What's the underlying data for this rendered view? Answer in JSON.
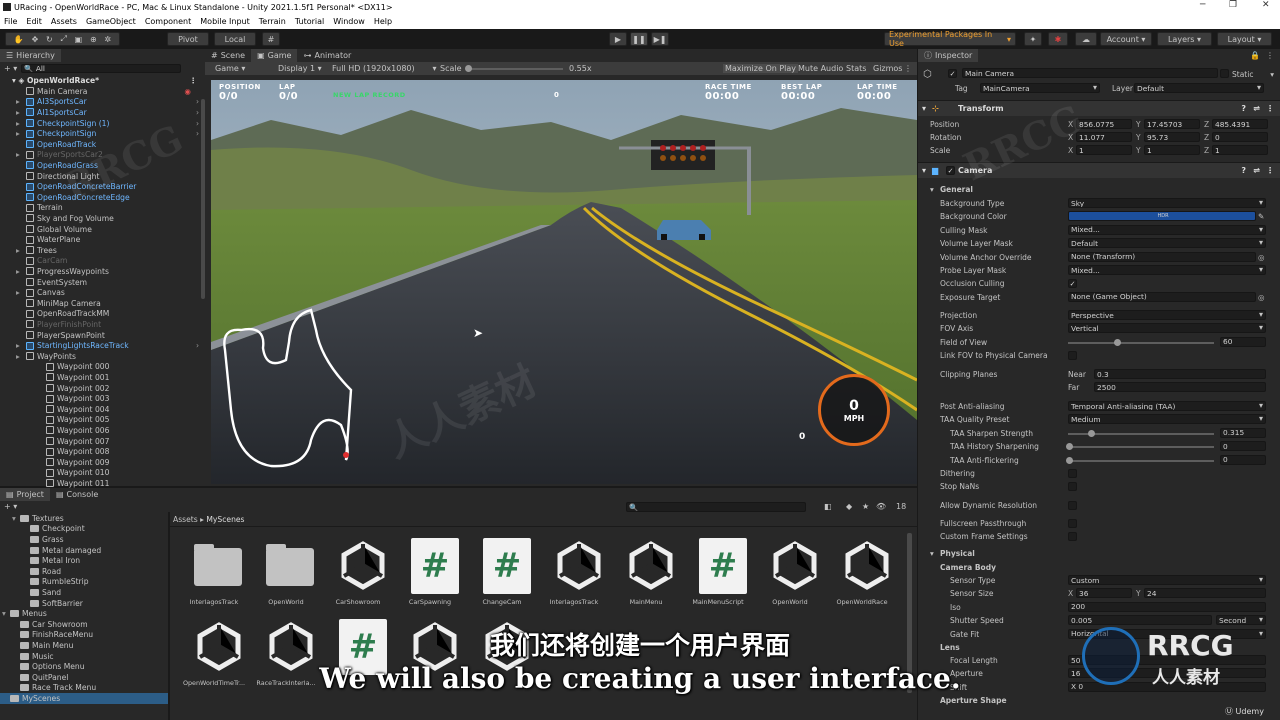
{
  "window": {
    "title": "URacing - OpenWorldRace - PC, Mac & Linux Standalone - Unity 2021.1.5f1 Personal* <DX11>"
  },
  "menu": [
    "File",
    "Edit",
    "Assets",
    "GameObject",
    "Component",
    "Mobile Input",
    "Terrain",
    "Tutorial",
    "Window",
    "Help"
  ],
  "toolbar": {
    "pivot": "Pivot",
    "local": "Local",
    "experimental": "Experimental Packages In Use",
    "account": "Account",
    "layers": "Layers",
    "layout": "Layout"
  },
  "hierarchy": {
    "tab": "Hierarchy",
    "search": "All",
    "scene": "OpenWorldRace*",
    "items": [
      {
        "label": "Main Camera",
        "style": "normal",
        "indent": 1,
        "arrow": false
      },
      {
        "label": "AI3SportsCar",
        "style": "blue",
        "indent": 1,
        "arrow": true
      },
      {
        "label": "AI1SportsCar",
        "style": "blue",
        "indent": 1,
        "arrow": true
      },
      {
        "label": "CheckpointSign (1)",
        "style": "blue",
        "indent": 1,
        "arrow": true
      },
      {
        "label": "CheckpointSign",
        "style": "blue",
        "indent": 1,
        "arrow": true
      },
      {
        "label": "OpenRoadTrack",
        "style": "blue",
        "indent": 1,
        "arrow": false
      },
      {
        "label": "PlayerSportsCar2",
        "style": "grey",
        "indent": 1,
        "arrow": true
      },
      {
        "label": "OpenRoadGrass",
        "style": "blue",
        "indent": 1,
        "arrow": false
      },
      {
        "label": "Directional Light",
        "style": "normal",
        "indent": 1,
        "arrow": false
      },
      {
        "label": "OpenRoadConcreteBarrier",
        "style": "blue",
        "indent": 1,
        "arrow": false
      },
      {
        "label": "OpenRoadConcreteEdge",
        "style": "blue",
        "indent": 1,
        "arrow": false
      },
      {
        "label": "Terrain",
        "style": "normal",
        "indent": 1,
        "arrow": false
      },
      {
        "label": "Sky and Fog Volume",
        "style": "normal",
        "indent": 1,
        "arrow": false
      },
      {
        "label": "Global Volume",
        "style": "normal",
        "indent": 1,
        "arrow": false
      },
      {
        "label": "WaterPlane",
        "style": "normal",
        "indent": 1,
        "arrow": false
      },
      {
        "label": "Trees",
        "style": "normal",
        "indent": 1,
        "arrow": true
      },
      {
        "label": "CarCam",
        "style": "grey",
        "indent": 1,
        "arrow": false
      },
      {
        "label": "ProgressWaypoints",
        "style": "normal",
        "indent": 1,
        "arrow": true
      },
      {
        "label": "EventSystem",
        "style": "normal",
        "indent": 1,
        "arrow": false
      },
      {
        "label": "Canvas",
        "style": "normal",
        "indent": 1,
        "arrow": true
      },
      {
        "label": "MiniMap Camera",
        "style": "normal",
        "indent": 1,
        "arrow": false
      },
      {
        "label": "OpenRoadTrackMM",
        "style": "normal",
        "indent": 1,
        "arrow": false
      },
      {
        "label": "PlayerFinishPoint",
        "style": "grey",
        "indent": 1,
        "arrow": false
      },
      {
        "label": "PlayerSpawnPoint",
        "style": "normal",
        "indent": 1,
        "arrow": false
      },
      {
        "label": "StartingLightsRaceTrack",
        "style": "blue",
        "indent": 1,
        "arrow": true
      },
      {
        "label": "WayPoints",
        "style": "normal",
        "indent": 1,
        "arrow": true
      },
      {
        "label": "Waypoint 000",
        "style": "normal",
        "indent": 2,
        "arrow": false
      },
      {
        "label": "Waypoint 001",
        "style": "normal",
        "indent": 2,
        "arrow": false
      },
      {
        "label": "Waypoint 002",
        "style": "normal",
        "indent": 2,
        "arrow": false
      },
      {
        "label": "Waypoint 003",
        "style": "normal",
        "indent": 2,
        "arrow": false
      },
      {
        "label": "Waypoint 004",
        "style": "normal",
        "indent": 2,
        "arrow": false
      },
      {
        "label": "Waypoint 005",
        "style": "normal",
        "indent": 2,
        "arrow": false
      },
      {
        "label": "Waypoint 006",
        "style": "normal",
        "indent": 2,
        "arrow": false
      },
      {
        "label": "Waypoint 007",
        "style": "normal",
        "indent": 2,
        "arrow": false
      },
      {
        "label": "Waypoint 008",
        "style": "normal",
        "indent": 2,
        "arrow": false
      },
      {
        "label": "Waypoint 009",
        "style": "normal",
        "indent": 2,
        "arrow": false
      },
      {
        "label": "Waypoint 010",
        "style": "normal",
        "indent": 2,
        "arrow": false
      },
      {
        "label": "Waypoint 011",
        "style": "normal",
        "indent": 2,
        "arrow": false
      }
    ]
  },
  "game": {
    "tabs": [
      "Scene",
      "Game",
      "Animator"
    ],
    "display_mode": "Game",
    "display": "Display 1",
    "resolution": "Full HD (1920x1080)",
    "scale_label": "Scale",
    "scale_value": "0.55x",
    "options": [
      "Maximize On Play",
      "Mute Audio",
      "Stats",
      "Gizmos"
    ],
    "hud": {
      "position_label": "POSITION",
      "position_value": "0/0",
      "lap_label": "LAP",
      "lap_value": "0/0",
      "new_lap": "NEW LAP RECORD",
      "center_value": "0",
      "race_time_label": "RACE TIME",
      "race_time_value": "00:00",
      "best_lap_label": "BEST LAP",
      "best_lap_value": "00:00",
      "lap_time_label": "LAP TIME",
      "lap_time_value": "00:00",
      "speed_value": "0",
      "speed_unit": "MPH",
      "gear_value": "0"
    }
  },
  "inspector": {
    "tab": "Inspector",
    "object_name": "Main Camera",
    "static_label": "Static",
    "tag_label": "Tag",
    "tag_value": "MainCamera",
    "layer_label": "Layer",
    "layer_value": "Default",
    "transform": {
      "title": "Transform",
      "position": {
        "label": "Position",
        "x": "856.0775",
        "y": "17.45703",
        "z": "485.4391"
      },
      "rotation": {
        "label": "Rotation",
        "x": "11.077",
        "y": "95.73",
        "z": "0"
      },
      "scale": {
        "label": "Scale",
        "x": "1",
        "y": "1",
        "z": "1"
      }
    },
    "camera_title": "Camera",
    "general_label": "General",
    "props": [
      {
        "label": "Background Type",
        "value": "Sky",
        "kind": "dd"
      },
      {
        "label": "Background Color",
        "value": "HDR",
        "kind": "color"
      },
      {
        "label": "Culling Mask",
        "value": "Mixed...",
        "kind": "dd"
      },
      {
        "label": "Volume Layer Mask",
        "value": "Default",
        "kind": "dd"
      },
      {
        "label": "Volume Anchor Override",
        "value": "None (Transform)",
        "kind": "obj"
      },
      {
        "label": "Probe Layer Mask",
        "value": "Mixed...",
        "kind": "dd"
      },
      {
        "label": "Occlusion Culling",
        "value": "✓",
        "kind": "chk"
      },
      {
        "label": "Exposure Target",
        "value": "None (Game Object)",
        "kind": "obj"
      }
    ],
    "projection": [
      {
        "label": "Projection",
        "value": "Perspective",
        "kind": "dd"
      },
      {
        "label": "FOV Axis",
        "value": "Vertical",
        "kind": "dd"
      },
      {
        "label": "Field of View",
        "value": "60",
        "kind": "slider",
        "fill": 0.33
      },
      {
        "label": "Link FOV to Physical Camera",
        "value": "",
        "kind": "chk"
      }
    ],
    "clipping": {
      "label": "Clipping Planes",
      "near_label": "Near",
      "near": "0.3",
      "far_label": "Far",
      "far": "2500"
    },
    "aa": [
      {
        "label": "Post Anti-aliasing",
        "value": "Temporal Anti-aliasing (TAA)",
        "kind": "dd"
      },
      {
        "label": "TAA Quality Preset",
        "value": "Medium",
        "kind": "dd"
      },
      {
        "label": "TAA Sharpen Strength",
        "value": "0.315",
        "kind": "slider",
        "fill": 0.15
      },
      {
        "label": "TAA History Sharpening",
        "value": "0",
        "kind": "slider",
        "fill": 0
      },
      {
        "label": "TAA Anti-flickering",
        "value": "0",
        "kind": "slider",
        "fill": 0
      }
    ],
    "misc": [
      {
        "label": "Dithering"
      },
      {
        "label": "Stop NaNs"
      },
      {
        "label": "Allow Dynamic Resolution"
      },
      {
        "label": "Fullscreen Passthrough"
      },
      {
        "label": "Custom Frame Settings"
      }
    ],
    "physical_label": "Physical",
    "camera_body_label": "Camera Body",
    "physical": [
      {
        "label": "Sensor Type",
        "value": "Custom",
        "kind": "dd"
      },
      {
        "label": "Sensor Size",
        "x": "36",
        "y": "24",
        "kind": "xy"
      },
      {
        "label": "Iso",
        "value": "200",
        "kind": "num"
      },
      {
        "label": "Shutter Speed",
        "value": "0.005",
        "unit": "Second",
        "kind": "unit"
      },
      {
        "label": "Gate Fit",
        "value": "Horizontal",
        "kind": "dd"
      }
    ],
    "lens_label": "Lens",
    "lens": [
      {
        "label": "Focal Length",
        "value": "50"
      },
      {
        "label": "Aperture",
        "value": "16"
      },
      {
        "label": "Shift",
        "value": "X 0"
      }
    ],
    "aperture_shape": "Aperture Shape"
  },
  "project": {
    "tabs": [
      "Project",
      "Console"
    ],
    "breadcrumb": [
      "Assets",
      "MyScenes"
    ],
    "count": "18",
    "tree": [
      {
        "label": "Textures",
        "indent": 1,
        "arrow": true
      },
      {
        "label": "Checkpoint",
        "indent": 2,
        "arrow": false
      },
      {
        "label": "Grass",
        "indent": 2,
        "arrow": false
      },
      {
        "label": "Metal damaged",
        "indent": 2,
        "arrow": false
      },
      {
        "label": "Metal Iron",
        "indent": 2,
        "arrow": false
      },
      {
        "label": "Road",
        "indent": 2,
        "arrow": false
      },
      {
        "label": "RumbleStrip",
        "indent": 2,
        "arrow": false
      },
      {
        "label": "Sand",
        "indent": 2,
        "arrow": false
      },
      {
        "label": "SoftBarrier",
        "indent": 2,
        "arrow": false
      },
      {
        "label": "Menus",
        "indent": 0,
        "arrow": true
      },
      {
        "label": "Car Showroom",
        "indent": 1,
        "arrow": false
      },
      {
        "label": "FinishRaceMenu",
        "indent": 1,
        "arrow": false
      },
      {
        "label": "Main Menu",
        "indent": 1,
        "arrow": false
      },
      {
        "label": "Music",
        "indent": 1,
        "arrow": false
      },
      {
        "label": "Options Menu",
        "indent": 1,
        "arrow": false
      },
      {
        "label": "QuitPanel",
        "indent": 1,
        "arrow": false
      },
      {
        "label": "Race Track Menu",
        "indent": 1,
        "arrow": false
      },
      {
        "label": "MyScenes",
        "indent": 0,
        "arrow": false
      }
    ],
    "assets_row1": [
      {
        "name": "InterlagosTrack",
        "kind": "folder"
      },
      {
        "name": "OpenWorld",
        "kind": "folder"
      },
      {
        "name": "CarShowroom",
        "kind": "unity"
      },
      {
        "name": "CarSpawning",
        "kind": "script"
      },
      {
        "name": "ChangeCam",
        "kind": "script"
      },
      {
        "name": "InterlagosTrack",
        "kind": "unity"
      },
      {
        "name": "MainMenu",
        "kind": "unity"
      },
      {
        "name": "MainMenuScript",
        "kind": "script"
      },
      {
        "name": "OpenWorld",
        "kind": "unity"
      },
      {
        "name": "OpenWorldRace",
        "kind": "unity"
      }
    ],
    "assets_row2": [
      {
        "name": "OpenWorldTimeTr...",
        "kind": "unity"
      },
      {
        "name": "RaceTrackInterla...",
        "kind": "unity"
      },
      {
        "name": "",
        "kind": "script"
      },
      {
        "name": "",
        "kind": "unity"
      },
      {
        "name": "",
        "kind": "unity"
      }
    ]
  },
  "subtitles": {
    "chinese": "我们还将创建一个用户界面",
    "english": "We will also be creating a user interface."
  },
  "watermark": {
    "brand": "RRCG",
    "cn": "人人素材",
    "udemy": "Udemy"
  }
}
